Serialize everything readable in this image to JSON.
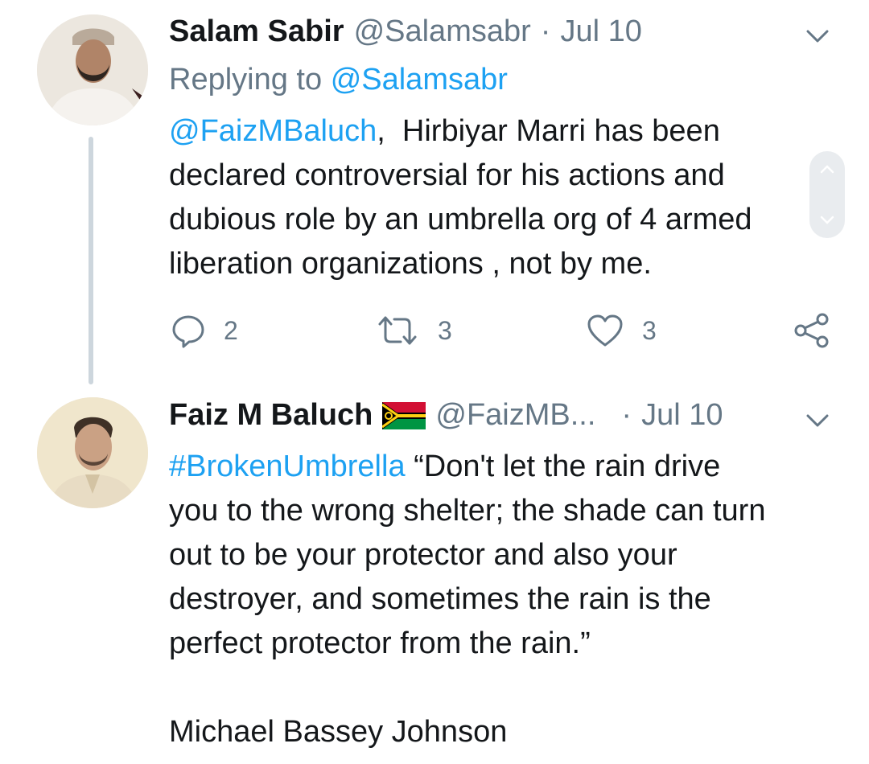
{
  "tweets": [
    {
      "display_name": "Salam Sabir",
      "handle": "@Salamsabr",
      "separator": "·",
      "date": "Jul 10",
      "replying_prefix": "Replying to",
      "replying_handle": "@Salamsabr",
      "mention": "@FaizMBaluch",
      "mention_suffix": ",",
      "text_line1": "Hirbiyar Marri has been",
      "text_lines": [
        "declared controversial for his actions and",
        "dubious role by an umbrella org of 4 armed",
        "liberation organizations , not by me."
      ],
      "reply_count": "2",
      "retweet_count": "3",
      "like_count": "3"
    },
    {
      "display_name": "Faiz M Baluch",
      "flag_icon": "vanuatu-flag-emoji",
      "handle": "@FaizMB...",
      "separator": "·",
      "date": "Jul 10",
      "hashtag": "#BrokenUmbrella",
      "text_line1": "“Don't let the rain drive",
      "text_lines": [
        "you to the wrong shelter; the shade can turn",
        "out to be your protector and also your",
        "destroyer, and sometimes the rain is the",
        "perfect protector from the rain.”"
      ],
      "attribution": "Michael Bassey Johnson"
    }
  ],
  "colors": {
    "link_blue": "#1da1f2",
    "meta_gray": "#657786",
    "text_dark": "#14171a",
    "thread_line": "#cdd6dd"
  }
}
